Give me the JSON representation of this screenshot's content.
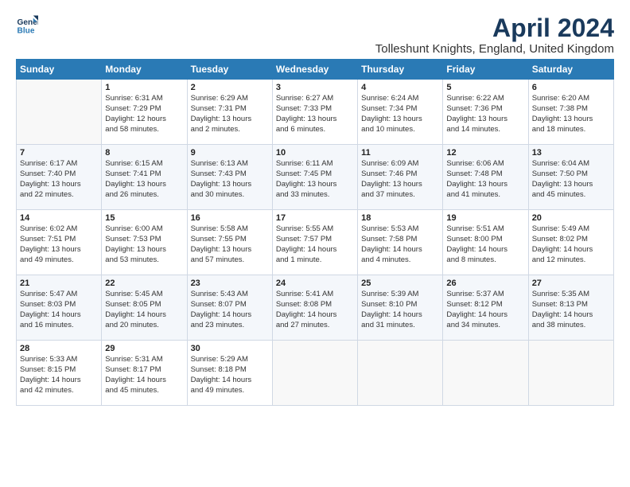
{
  "header": {
    "logo_line1": "General",
    "logo_line2": "Blue",
    "month": "April 2024",
    "location": "Tolleshunt Knights, England, United Kingdom"
  },
  "weekdays": [
    "Sunday",
    "Monday",
    "Tuesday",
    "Wednesday",
    "Thursday",
    "Friday",
    "Saturday"
  ],
  "weeks": [
    [
      {
        "day": "",
        "info": ""
      },
      {
        "day": "1",
        "info": "Sunrise: 6:31 AM\nSunset: 7:29 PM\nDaylight: 12 hours\nand 58 minutes."
      },
      {
        "day": "2",
        "info": "Sunrise: 6:29 AM\nSunset: 7:31 PM\nDaylight: 13 hours\nand 2 minutes."
      },
      {
        "day": "3",
        "info": "Sunrise: 6:27 AM\nSunset: 7:33 PM\nDaylight: 13 hours\nand 6 minutes."
      },
      {
        "day": "4",
        "info": "Sunrise: 6:24 AM\nSunset: 7:34 PM\nDaylight: 13 hours\nand 10 minutes."
      },
      {
        "day": "5",
        "info": "Sunrise: 6:22 AM\nSunset: 7:36 PM\nDaylight: 13 hours\nand 14 minutes."
      },
      {
        "day": "6",
        "info": "Sunrise: 6:20 AM\nSunset: 7:38 PM\nDaylight: 13 hours\nand 18 minutes."
      }
    ],
    [
      {
        "day": "7",
        "info": "Sunrise: 6:17 AM\nSunset: 7:40 PM\nDaylight: 13 hours\nand 22 minutes."
      },
      {
        "day": "8",
        "info": "Sunrise: 6:15 AM\nSunset: 7:41 PM\nDaylight: 13 hours\nand 26 minutes."
      },
      {
        "day": "9",
        "info": "Sunrise: 6:13 AM\nSunset: 7:43 PM\nDaylight: 13 hours\nand 30 minutes."
      },
      {
        "day": "10",
        "info": "Sunrise: 6:11 AM\nSunset: 7:45 PM\nDaylight: 13 hours\nand 33 minutes."
      },
      {
        "day": "11",
        "info": "Sunrise: 6:09 AM\nSunset: 7:46 PM\nDaylight: 13 hours\nand 37 minutes."
      },
      {
        "day": "12",
        "info": "Sunrise: 6:06 AM\nSunset: 7:48 PM\nDaylight: 13 hours\nand 41 minutes."
      },
      {
        "day": "13",
        "info": "Sunrise: 6:04 AM\nSunset: 7:50 PM\nDaylight: 13 hours\nand 45 minutes."
      }
    ],
    [
      {
        "day": "14",
        "info": "Sunrise: 6:02 AM\nSunset: 7:51 PM\nDaylight: 13 hours\nand 49 minutes."
      },
      {
        "day": "15",
        "info": "Sunrise: 6:00 AM\nSunset: 7:53 PM\nDaylight: 13 hours\nand 53 minutes."
      },
      {
        "day": "16",
        "info": "Sunrise: 5:58 AM\nSunset: 7:55 PM\nDaylight: 13 hours\nand 57 minutes."
      },
      {
        "day": "17",
        "info": "Sunrise: 5:55 AM\nSunset: 7:57 PM\nDaylight: 14 hours\nand 1 minute."
      },
      {
        "day": "18",
        "info": "Sunrise: 5:53 AM\nSunset: 7:58 PM\nDaylight: 14 hours\nand 4 minutes."
      },
      {
        "day": "19",
        "info": "Sunrise: 5:51 AM\nSunset: 8:00 PM\nDaylight: 14 hours\nand 8 minutes."
      },
      {
        "day": "20",
        "info": "Sunrise: 5:49 AM\nSunset: 8:02 PM\nDaylight: 14 hours\nand 12 minutes."
      }
    ],
    [
      {
        "day": "21",
        "info": "Sunrise: 5:47 AM\nSunset: 8:03 PM\nDaylight: 14 hours\nand 16 minutes."
      },
      {
        "day": "22",
        "info": "Sunrise: 5:45 AM\nSunset: 8:05 PM\nDaylight: 14 hours\nand 20 minutes."
      },
      {
        "day": "23",
        "info": "Sunrise: 5:43 AM\nSunset: 8:07 PM\nDaylight: 14 hours\nand 23 minutes."
      },
      {
        "day": "24",
        "info": "Sunrise: 5:41 AM\nSunset: 8:08 PM\nDaylight: 14 hours\nand 27 minutes."
      },
      {
        "day": "25",
        "info": "Sunrise: 5:39 AM\nSunset: 8:10 PM\nDaylight: 14 hours\nand 31 minutes."
      },
      {
        "day": "26",
        "info": "Sunrise: 5:37 AM\nSunset: 8:12 PM\nDaylight: 14 hours\nand 34 minutes."
      },
      {
        "day": "27",
        "info": "Sunrise: 5:35 AM\nSunset: 8:13 PM\nDaylight: 14 hours\nand 38 minutes."
      }
    ],
    [
      {
        "day": "28",
        "info": "Sunrise: 5:33 AM\nSunset: 8:15 PM\nDaylight: 14 hours\nand 42 minutes."
      },
      {
        "day": "29",
        "info": "Sunrise: 5:31 AM\nSunset: 8:17 PM\nDaylight: 14 hours\nand 45 minutes."
      },
      {
        "day": "30",
        "info": "Sunrise: 5:29 AM\nSunset: 8:18 PM\nDaylight: 14 hours\nand 49 minutes."
      },
      {
        "day": "",
        "info": ""
      },
      {
        "day": "",
        "info": ""
      },
      {
        "day": "",
        "info": ""
      },
      {
        "day": "",
        "info": ""
      }
    ]
  ]
}
